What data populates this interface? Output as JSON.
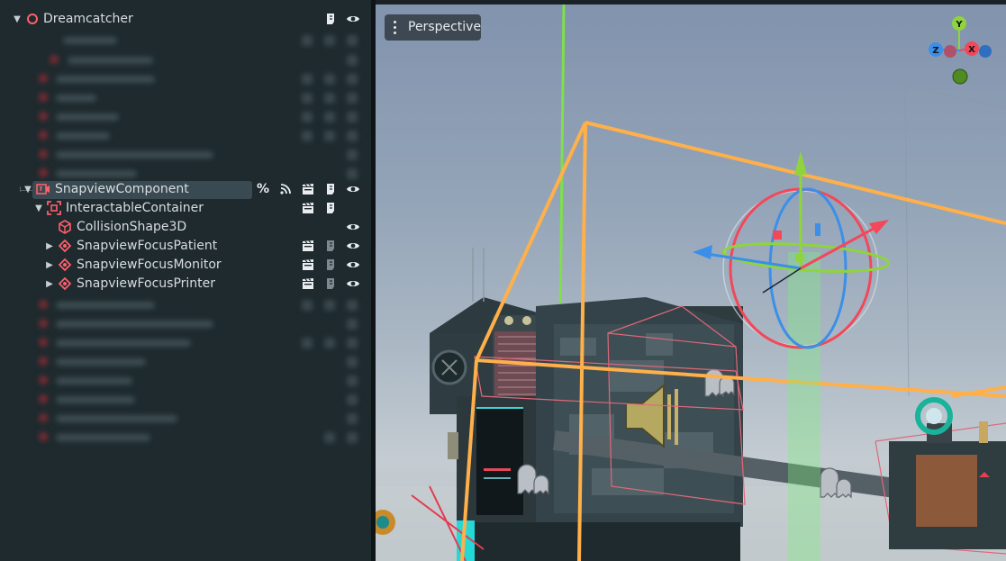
{
  "scene_tree": {
    "root": {
      "label": "Dreamcatcher"
    },
    "nodes": [
      {
        "label": "SnapviewComponent",
        "selected": true,
        "expanded": true,
        "icon": "snapview-component-icon",
        "badges": [
          "unique-name-icon",
          "signal-icon",
          "clapper-icon",
          "script-icon",
          "visibility-eye-icon"
        ]
      },
      {
        "label": "InteractableContainer",
        "expanded": true,
        "icon": "area3d-icon",
        "badges": [
          "clapper-icon",
          "script-icon"
        ]
      },
      {
        "label": "CollisionShape3D",
        "icon": "collision-shape-icon",
        "badges": [
          "visibility-eye-icon"
        ]
      },
      {
        "label": "SnapviewFocusPatient",
        "expanded": false,
        "icon": "focus-node-icon",
        "badges": [
          "clapper-icon",
          "script-icon",
          "visibility-eye-icon"
        ]
      },
      {
        "label": "SnapviewFocusMonitor",
        "expanded": false,
        "icon": "focus-node-icon",
        "badges": [
          "clapper-icon",
          "script-icon",
          "visibility-eye-icon"
        ]
      },
      {
        "label": "SnapviewFocusPrinter",
        "expanded": false,
        "icon": "focus-node-icon",
        "badges": [
          "clapper-icon",
          "script-icon",
          "visibility-eye-icon"
        ]
      }
    ]
  },
  "viewport": {
    "view_menu_label": "Perspective",
    "axis_gizmo": {
      "y": "Y",
      "z": "Z",
      "x": "X"
    }
  },
  "colors": {
    "panel_bg": "#1e2a2e",
    "selection_bg": "#3a4a52",
    "node_red": "#ff5f6b",
    "bounds_orange": "#ffb04a",
    "gizmo_x": "#f2485a",
    "gizmo_y": "#8fd43c",
    "gizmo_z": "#3b8fe8"
  }
}
